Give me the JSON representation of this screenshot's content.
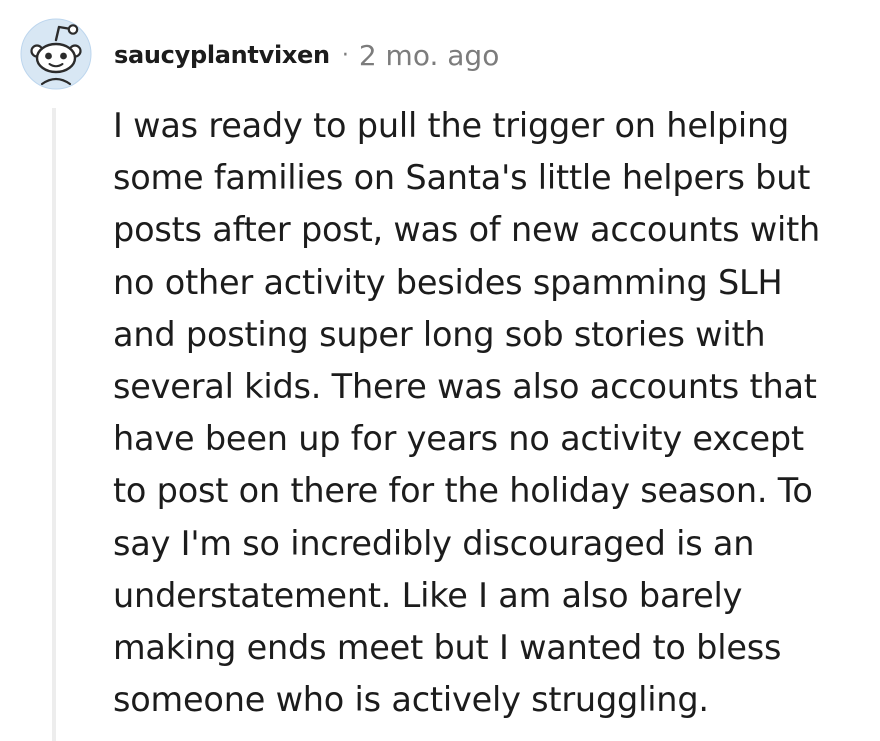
{
  "comment": {
    "username": "saucyplantvixen",
    "separator": "·",
    "timestamp": "2 mo. ago",
    "avatar_icon": "reddit-snoo-icon",
    "body_lines": [
      "I was ready to pull the trigger on helping",
      "some families on Santa's little helpers but",
      "posts after post, was of new accounts with",
      "no other activity besides spamming SLH",
      "and posting super long sob stories with",
      "several kids. There was also accounts that",
      "have been up for years no activity except",
      "to post on there for the holiday season. To",
      "say I'm so incredibly discouraged is an",
      "understatement. Like I am also barely",
      "making ends meet but I wanted to bless",
      "someone who is actively struggling."
    ]
  },
  "colors": {
    "avatar_bg": "#d8e7f4",
    "avatar_ring": "#bdd6ee",
    "text_primary": "#1c1c1c",
    "text_meta": "#7c7c7c",
    "thread_line": "#ededed"
  }
}
